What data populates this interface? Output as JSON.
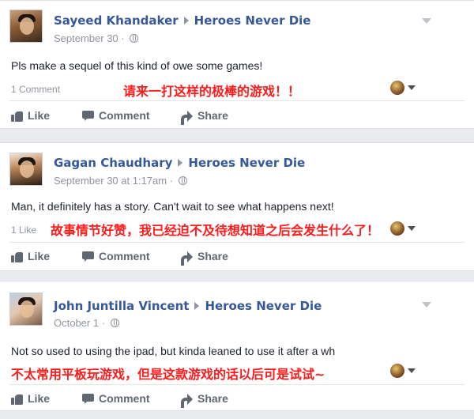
{
  "posts": [
    {
      "author": "Sayeed Khandaker",
      "page": "Heroes Never Die",
      "timestamp": "September 30",
      "text": "Pls make a sequel of this kind of owe some games!",
      "count": "1 Comment",
      "caption": "请来一打这样的极棒的游戏！！",
      "actions": {
        "like": "Like",
        "comment": "Comment",
        "share": "Share"
      }
    },
    {
      "author": "Gagan Chaudhary",
      "page": "Heroes Never Die",
      "timestamp": "September 30 at 1:17am",
      "text": "Man, it definitely has a story. Can't wait to see what happens next!",
      "count": "1 Like",
      "caption": "故事情节好赞，我已经迫不及待想知道之后会发生什么了！",
      "actions": {
        "like": "Like",
        "comment": "Comment",
        "share": "Share"
      }
    },
    {
      "author": "John Juntilla Vincent",
      "page": "Heroes Never Die",
      "timestamp": "October 1",
      "text": "Not so used to using the ipad, but kinda leaned to use it after a wh",
      "count": "",
      "caption": "不太常用平板玩游戏，但是这款游戏的话以后可是试试~",
      "actions": {
        "like": "Like",
        "comment": "Comment",
        "share": "Share"
      }
    }
  ],
  "icons": {
    "privacy": "globe-icon",
    "options": "chevron-down-icon",
    "reaction": "reaction-avatar-icon",
    "like": "thumbs-up-icon",
    "comment": "speech-bubble-icon",
    "share": "share-arrow-icon"
  },
  "colors": {
    "link": "#365899",
    "meta": "#90949c",
    "caption": "#ff1a1a",
    "action": "#606770",
    "background": "#e9ebee"
  }
}
